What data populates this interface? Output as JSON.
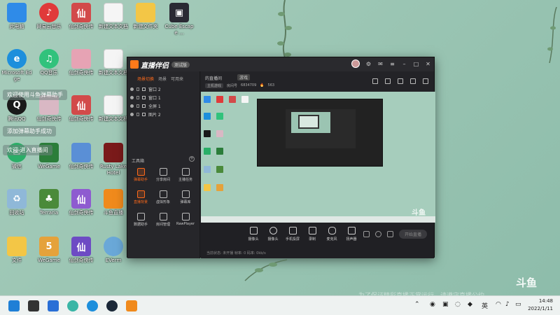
{
  "desktop": {
    "icons": [
      {
        "label": "此电脑",
        "color": "#2f8be8"
      },
      {
        "label": "网易云音乐",
        "color": "#e03a3a"
      },
      {
        "label": "仙剑奇侠传",
        "color": "#d24a4a"
      },
      {
        "label": "新建文本文档",
        "color": "#f5f5f5"
      },
      {
        "label": "新建文件夹",
        "color": "#f3c646"
      },
      {
        "label": "Cube Escape ...",
        "color": "#2a2a33"
      },
      {
        "label": "Microsoft Edge",
        "color": "#1d8fdc"
      },
      {
        "label": "QQ音乐",
        "color": "#31c27c"
      },
      {
        "label": "新建文本文档",
        "color": "#f5f5f5"
      },
      {
        "label": "腾讯QQ",
        "color": "#1a1a1a"
      },
      {
        "label": "微信",
        "color": "#2aae67"
      },
      {
        "label": "Rusty Lake Hotel",
        "color": "#7a1a1a"
      },
      {
        "label": "回收站",
        "color": "#8fb8d8"
      },
      {
        "label": "Terraria",
        "color": "#4a8a3a"
      },
      {
        "label": "仙剑奇侠传",
        "color": "#8e5bd0"
      },
      {
        "label": "斗鱼直播",
        "color": "#f08a1c"
      },
      {
        "label": "文件",
        "color": "#f3c646"
      },
      {
        "label": "WeGame",
        "color": "#e5a23b"
      },
      {
        "label": "仙剑奇侠传",
        "color": "#6d4bc4"
      },
      {
        "label": "EVerm",
        "color": "#6aa8d8"
      }
    ]
  },
  "notifications": [
    "欢迎使用斗鱼弹幕助手",
    "添加弹幕助手成功",
    "欢迎 进入直播间"
  ],
  "app": {
    "title": "直播伴侣",
    "beta": "测试版",
    "scene_tabs": [
      "场景切换",
      "场景",
      "可用来"
    ],
    "sources": [
      "窗口 2",
      "窗口 1",
      "全屏 1",
      "图片 2"
    ],
    "tools_title": "工具箱",
    "tools": [
      {
        "label": "弹幕助手",
        "highlight": true
      },
      {
        "label": "分享房间",
        "highlight": false
      },
      {
        "label": "主播任务",
        "highlight": false
      },
      {
        "label": "直播背景",
        "highlight": true
      },
      {
        "label": "虚拟形象",
        "highlight": false
      },
      {
        "label": "弹幕库",
        "highlight": false
      },
      {
        "label": "数据助手",
        "highlight": false
      },
      {
        "label": "房间管理",
        "highlight": false
      },
      {
        "label": "RawPlayer",
        "highlight": false
      }
    ],
    "room": {
      "name": "的直播间",
      "tag": "游戏",
      "category": "主机游戏",
      "room_id_label": "房间号",
      "room_id": "6834709",
      "viewers": "563"
    },
    "controls": [
      "摄像头",
      "摄像头",
      "手机投屏",
      "录制",
      "麦克风",
      "扬声器"
    ],
    "start_label": "开始直播",
    "status": "当前状态: 未开播  帧率: 0  码率: 0kb/s"
  },
  "preview": {
    "watermark": "斗鱼"
  },
  "overlay": {
    "bottom_text": "为了保证精彩直播正常运行，请遵守直播公约",
    "douyu_logo": "斗鱼"
  },
  "taskbar": {
    "lang": "英",
    "time": "14:48",
    "date": "2022/1/11"
  }
}
